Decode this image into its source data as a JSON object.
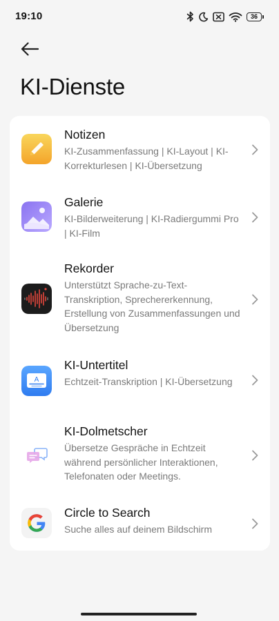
{
  "status_bar": {
    "time": "19:10",
    "battery": "36",
    "icons": [
      "bluetooth-icon",
      "moon-icon",
      "no-sim-icon",
      "wifi-icon",
      "battery-icon"
    ]
  },
  "header": {
    "back_icon": "arrow-left-icon",
    "title": "KI-Dienste"
  },
  "services": [
    {
      "title": "Notizen",
      "description": "KI-Zusammenfassung | KI-Layout | KI-Korrekturlesen | KI-Übersetzung",
      "icon": "notes-icon",
      "colors": [
        "#f8d153",
        "#f5a623"
      ]
    },
    {
      "title": "Galerie",
      "description": "KI-Bilderweiterung | KI-Radiergummi Pro | KI-Film",
      "icon": "gallery-icon",
      "colors": [
        "#8f7bf3",
        "#c3b3ff"
      ]
    },
    {
      "title": "Rekorder",
      "description": "Unterstützt Sprache-zu-Text-Transkription, Sprechererkennung, Erstellung von Zusammenfassungen und Übersetzung",
      "icon": "recorder-icon",
      "colors": [
        "#1b1b1b",
        "#e0463c"
      ]
    },
    {
      "title": "KI-Untertitel",
      "description": "Echtzeit-Transkription | KI-Übersetzung",
      "icon": "subtitles-icon",
      "colors": [
        "#3a8cf6",
        "#6fb3ff"
      ]
    },
    {
      "title": "KI-Dolmetscher",
      "description": "Übersetze Gespräche in Echtzeit während persönlicher Interaktionen, Telefonaten oder Meetings.",
      "icon": "interpreter-icon",
      "colors": [
        "#d88fe0",
        "#8ab4f8"
      ]
    },
    {
      "title": "Circle to Search",
      "description": "Suche alles auf deinem Bildschirm",
      "icon": "google-icon",
      "colors": [
        "#4285f4",
        "#ea4335",
        "#fbbc05",
        "#34a853"
      ]
    }
  ]
}
